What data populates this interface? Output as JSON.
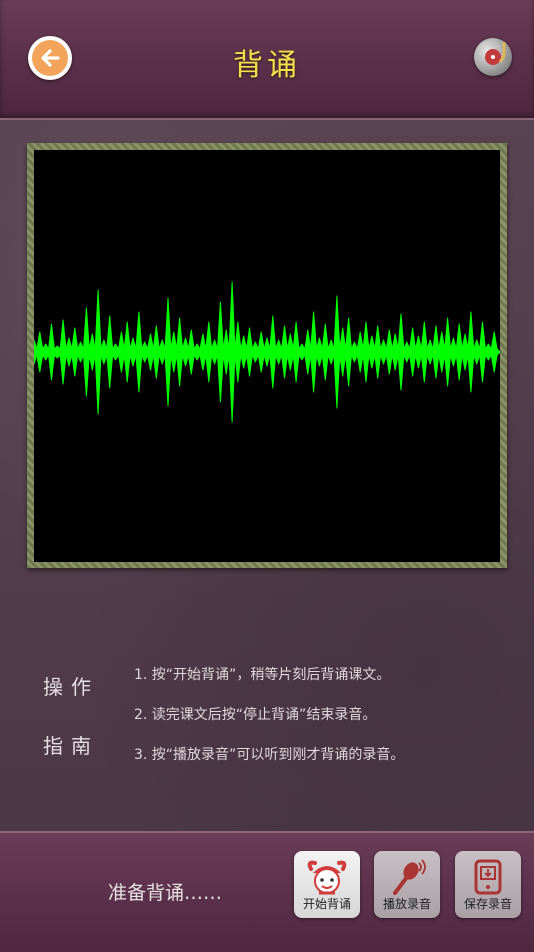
{
  "header": {
    "title": "背诵",
    "back_icon": "back-arrow-icon",
    "music_icon": "music-disc-icon"
  },
  "guide": {
    "label_line1": "操作",
    "label_line2": "指南",
    "steps": [
      "1. 按“开始背诵”，稍等片刻后背诵课文。",
      "2. 读完课文后按“停止背诵”结束录音。",
      "3. 按“播放录音”可以听到刚才背诵的录音。"
    ]
  },
  "footer": {
    "status": "准备背诵……",
    "buttons": [
      {
        "label": "开始背诵",
        "icon": "child-face-icon",
        "enabled": true
      },
      {
        "label": "播放录音",
        "icon": "microphone-icon",
        "enabled": false
      },
      {
        "label": "保存录音",
        "icon": "save-device-icon",
        "enabled": false
      }
    ]
  },
  "colors": {
    "accent": "#f5e047",
    "wave": "#00ff00",
    "back_button": "#f2a45a"
  }
}
